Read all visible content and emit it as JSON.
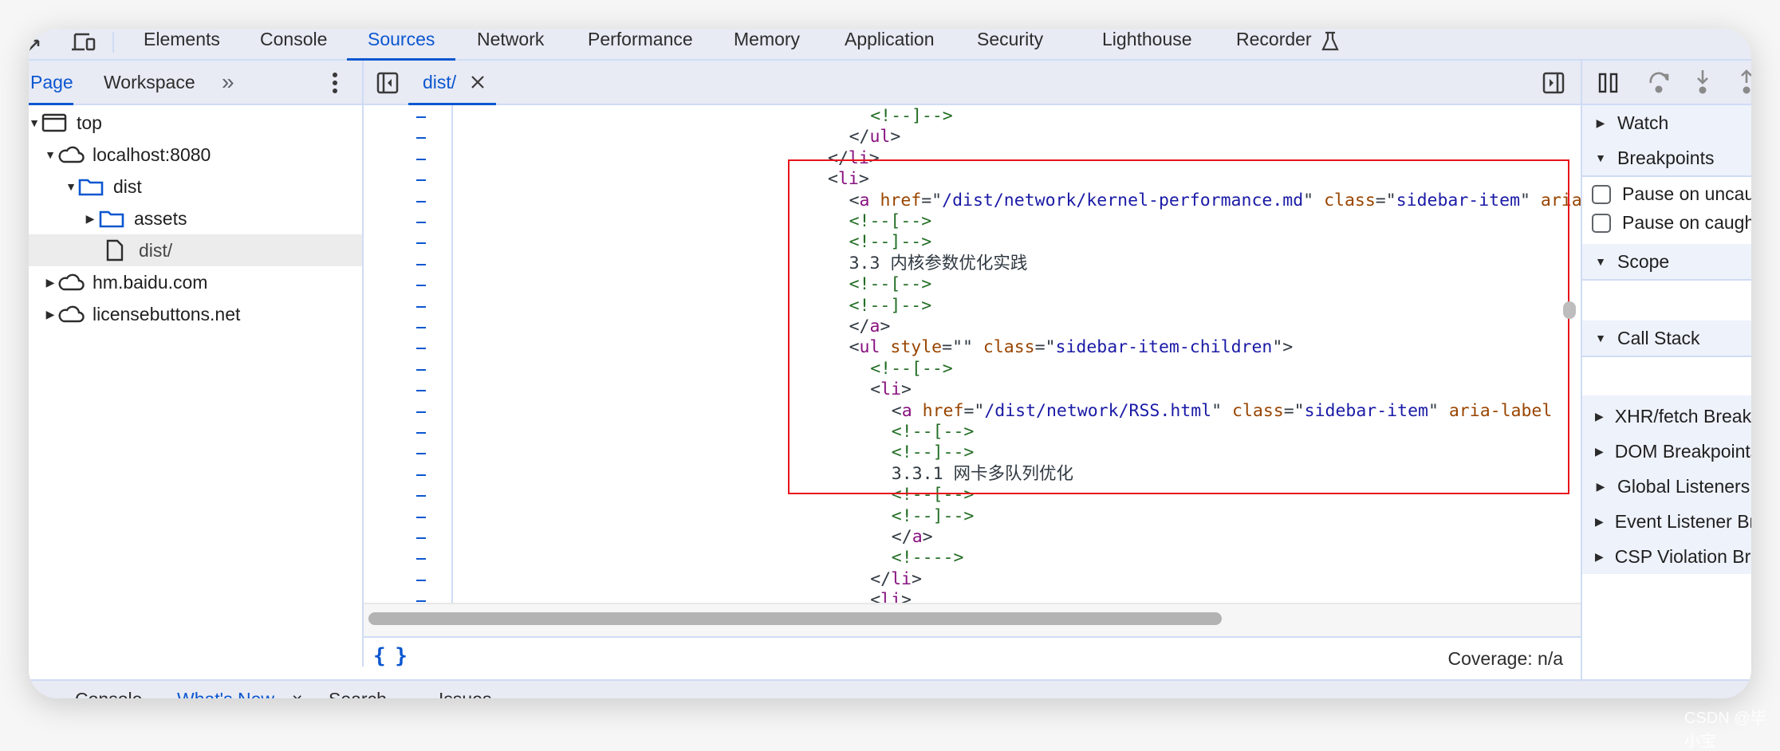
{
  "main_tabs": [
    {
      "label": "Elements",
      "active": false
    },
    {
      "label": "Console",
      "active": false
    },
    {
      "label": "Sources",
      "active": true
    },
    {
      "label": "Network",
      "active": false
    },
    {
      "label": "Performance",
      "active": false
    },
    {
      "label": "Memory",
      "active": false
    },
    {
      "label": "Application",
      "active": false
    },
    {
      "label": "Security",
      "active": false
    },
    {
      "label": "Lighthouse",
      "active": false
    },
    {
      "label": "Recorder",
      "active": false
    }
  ],
  "toolbar_icons": [
    "inspect-element-icon",
    "device-toolbar-icon",
    "recorder-flask-icon"
  ],
  "navigator": {
    "tabs": [
      {
        "label": "Page",
        "active": true
      },
      {
        "label": "Workspace",
        "active": false
      }
    ],
    "more_tabs": "»",
    "tree": [
      {
        "label": "top",
        "icon": "frame-icon",
        "expanded": true,
        "level": 0
      },
      {
        "label": "localhost:8080",
        "icon": "cloud-icon",
        "expanded": true,
        "level": 1
      },
      {
        "label": "dist",
        "icon": "folder-icon",
        "expanded": true,
        "level": 2
      },
      {
        "label": "assets",
        "icon": "folder-icon",
        "expanded": false,
        "level": 3
      },
      {
        "label": "dist/",
        "icon": "file-icon",
        "selected": true,
        "level": 3
      },
      {
        "label": "hm.baidu.com",
        "icon": "cloud-icon",
        "expanded": false,
        "level": 1
      },
      {
        "label": "licensebuttons.net",
        "icon": "cloud-icon",
        "expanded": false,
        "level": 1
      }
    ]
  },
  "editor": {
    "open_tab": "dist/",
    "line_marker": "–",
    "lines": [
      {
        "indent": 8,
        "tokens": [
          [
            "cm",
            "<!--]-->"
          ]
        ]
      },
      {
        "indent": 6,
        "tokens": [
          [
            "pn",
            "</"
          ],
          [
            "tg",
            "ul"
          ],
          [
            "pn",
            ">"
          ]
        ]
      },
      {
        "indent": 4,
        "tokens": [
          [
            "pn",
            "</"
          ],
          [
            "tg",
            "li"
          ],
          [
            "pn",
            ">"
          ]
        ]
      },
      {
        "indent": 4,
        "tokens": [
          [
            "pn",
            "<"
          ],
          [
            "tg",
            "li"
          ],
          [
            "pn",
            ">"
          ]
        ]
      },
      {
        "indent": 6,
        "tokens": [
          [
            "pn",
            "<"
          ],
          [
            "tg",
            "a"
          ],
          [
            "pn",
            " "
          ],
          [
            "at",
            "href"
          ],
          [
            "pn",
            "=\""
          ],
          [
            "av",
            "/dist/network/kernel-performance.md"
          ],
          [
            "pn",
            "\" "
          ],
          [
            "at",
            "class"
          ],
          [
            "pn",
            "=\""
          ],
          [
            "av",
            "sidebar-item"
          ],
          [
            "pn",
            "\" "
          ],
          [
            "at",
            "aria-label"
          ]
        ]
      },
      {
        "indent": 6,
        "tokens": [
          [
            "cm",
            "<!--[-->"
          ]
        ]
      },
      {
        "indent": 6,
        "tokens": [
          [
            "cm",
            "<!--]-->"
          ]
        ]
      },
      {
        "indent": 6,
        "tokens": [
          [
            "tx",
            "3.3 内核参数优化实践"
          ]
        ]
      },
      {
        "indent": 6,
        "tokens": [
          [
            "cm",
            "<!--[-->"
          ]
        ]
      },
      {
        "indent": 6,
        "tokens": [
          [
            "cm",
            "<!--]-->"
          ]
        ]
      },
      {
        "indent": 6,
        "tokens": [
          [
            "pn",
            "</"
          ],
          [
            "tg",
            "a"
          ],
          [
            "pn",
            ">"
          ]
        ]
      },
      {
        "indent": 6,
        "tokens": [
          [
            "pn",
            "<"
          ],
          [
            "tg",
            "ul"
          ],
          [
            "pn",
            " "
          ],
          [
            "at",
            "style"
          ],
          [
            "pn",
            "=\""
          ],
          [
            "av",
            ""
          ],
          [
            "pn",
            "\" "
          ],
          [
            "at",
            "class"
          ],
          [
            "pn",
            "=\""
          ],
          [
            "av",
            "sidebar-item-children"
          ],
          [
            "pn",
            "\">"
          ]
        ]
      },
      {
        "indent": 8,
        "tokens": [
          [
            "cm",
            "<!--[-->"
          ]
        ]
      },
      {
        "indent": 8,
        "tokens": [
          [
            "pn",
            "<"
          ],
          [
            "tg",
            "li"
          ],
          [
            "pn",
            ">"
          ]
        ]
      },
      {
        "indent": 10,
        "tokens": [
          [
            "pn",
            "<"
          ],
          [
            "tg",
            "a"
          ],
          [
            "pn",
            " "
          ],
          [
            "at",
            "href"
          ],
          [
            "pn",
            "=\""
          ],
          [
            "av",
            "/dist/network/RSS.html"
          ],
          [
            "pn",
            "\" "
          ],
          [
            "at",
            "class"
          ],
          [
            "pn",
            "=\""
          ],
          [
            "av",
            "sidebar-item"
          ],
          [
            "pn",
            "\" "
          ],
          [
            "at",
            "aria-label"
          ]
        ]
      },
      {
        "indent": 10,
        "tokens": [
          [
            "cm",
            "<!--[-->"
          ]
        ]
      },
      {
        "indent": 10,
        "tokens": [
          [
            "cm",
            "<!--]-->"
          ]
        ]
      },
      {
        "indent": 10,
        "tokens": [
          [
            "tx",
            "3.3.1 网卡多队列优化"
          ]
        ]
      },
      {
        "indent": 10,
        "tokens": [
          [
            "cm",
            "<!--[-->"
          ]
        ]
      },
      {
        "indent": 10,
        "tokens": [
          [
            "cm",
            "<!--]-->"
          ]
        ]
      },
      {
        "indent": 10,
        "tokens": [
          [
            "pn",
            "</"
          ],
          [
            "tg",
            "a"
          ],
          [
            "pn",
            ">"
          ]
        ]
      },
      {
        "indent": 10,
        "tokens": [
          [
            "cm",
            "<!---->"
          ]
        ]
      },
      {
        "indent": 8,
        "tokens": [
          [
            "pn",
            "</"
          ],
          [
            "tg",
            "li"
          ],
          [
            "pn",
            ">"
          ]
        ]
      },
      {
        "indent": 8,
        "tokens": [
          [
            "pn",
            "<"
          ],
          [
            "tg",
            "li"
          ],
          [
            "pn",
            ">"
          ]
        ]
      }
    ]
  },
  "status_bar": {
    "format_button": "{ }",
    "coverage": "Coverage: n/a"
  },
  "debugger": {
    "sections": [
      {
        "label": "Watch",
        "expanded": false
      },
      {
        "label": "Breakpoints",
        "expanded": true
      },
      {
        "label": "Scope",
        "expanded": true
      },
      {
        "label": "Call Stack",
        "expanded": true
      },
      {
        "label": "XHR/fetch Breakpoints",
        "expanded": false
      },
      {
        "label": "DOM Breakpoints",
        "expanded": false
      },
      {
        "label": "Global Listeners",
        "expanded": false
      },
      {
        "label": "Event Listener Breakpoints",
        "expanded": false
      },
      {
        "label": "CSP Violation Breakpoints",
        "expanded": false
      }
    ],
    "checkboxes": [
      {
        "label": "Pause on uncaught exceptions",
        "checked": false
      },
      {
        "label": "Pause on caught exceptions",
        "checked": false
      }
    ]
  },
  "drawer_tabs": [
    {
      "label": "Console",
      "active": false
    },
    {
      "label": "What's New",
      "active": true,
      "closable": true
    },
    {
      "label": "Search",
      "active": false
    },
    {
      "label": "Issues",
      "active": false
    }
  ],
  "watermark": "CSDN @毕小宝",
  "colors": {
    "accent": "#0b57d0",
    "highlight_box": "#e8141c",
    "toolbar_bg": "#e8eaf4"
  }
}
